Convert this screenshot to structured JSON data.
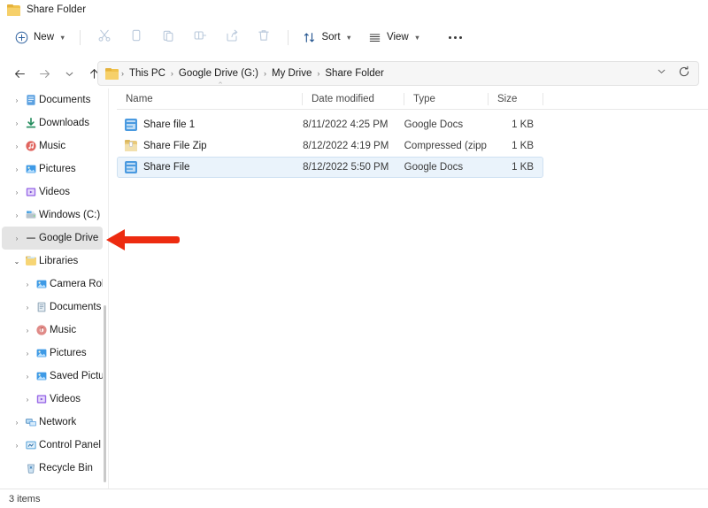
{
  "window": {
    "title": "Share Folder",
    "title_icon": "folder-icon"
  },
  "toolbar": {
    "new_label": "New",
    "new_icon": "plus-circle-icon",
    "sort_label": "Sort",
    "sort_icon": "sort-arrows-icon",
    "view_label": "View",
    "view_icon": "list-lines-icon",
    "more_label": "See more",
    "more_icon": "ellipsis-icon",
    "actions": [
      {
        "name": "cut",
        "icon": "scissors-icon",
        "enabled": false
      },
      {
        "name": "copy",
        "icon": "copy-icon",
        "enabled": false
      },
      {
        "name": "paste",
        "icon": "paste-icon",
        "enabled": false
      },
      {
        "name": "rename",
        "icon": "rename-icon",
        "enabled": false
      },
      {
        "name": "share",
        "icon": "share-icon",
        "enabled": false
      },
      {
        "name": "delete",
        "icon": "trash-icon",
        "enabled": false
      }
    ]
  },
  "navigation": {
    "back_icon": "arrow-left-icon",
    "forward_icon": "arrow-right-icon",
    "recent_icon": "chevron-down-icon",
    "up_icon": "arrow-up-icon",
    "refresh_icon": "refresh-icon",
    "dropdown_icon": "chevron-down-icon",
    "breadcrumb_icon": "folder-icon",
    "breadcrumb": [
      "This PC",
      "Google Drive (G:)",
      "My Drive",
      "Share Folder"
    ],
    "separator": "›"
  },
  "sidebar": {
    "items": [
      {
        "label": "Documents",
        "icon": "documents-icon",
        "indent": 1,
        "expander": "right",
        "selected": false
      },
      {
        "label": "Downloads",
        "icon": "downloads-icon",
        "indent": 1,
        "expander": "right",
        "selected": false
      },
      {
        "label": "Music",
        "icon": "music-icon",
        "indent": 1,
        "expander": "right",
        "selected": false
      },
      {
        "label": "Pictures",
        "icon": "pictures-icon",
        "indent": 1,
        "expander": "right",
        "selected": false
      },
      {
        "label": "Videos",
        "icon": "videos-icon",
        "indent": 1,
        "expander": "right",
        "selected": false
      },
      {
        "label": "Windows (C:)",
        "icon": "drive-icon",
        "indent": 1,
        "expander": "right",
        "selected": false
      },
      {
        "label": "Google Drive",
        "icon": "google-drive-icon",
        "indent": 1,
        "expander": "right",
        "selected": true
      },
      {
        "label": "Libraries",
        "icon": "libraries-icon",
        "indent": 0,
        "expander": "down",
        "selected": false
      },
      {
        "label": "Camera Roll",
        "icon": "pictures-icon",
        "indent": 2,
        "expander": "right",
        "selected": false
      },
      {
        "label": "Documents",
        "icon": "documents-lib-icon",
        "indent": 2,
        "expander": "right",
        "selected": false
      },
      {
        "label": "Music",
        "icon": "music-lib-icon",
        "indent": 2,
        "expander": "right",
        "selected": false
      },
      {
        "label": "Pictures",
        "icon": "pictures-icon",
        "indent": 2,
        "expander": "right",
        "selected": false
      },
      {
        "label": "Saved Picture",
        "icon": "pictures-icon",
        "indent": 2,
        "expander": "right",
        "selected": false
      },
      {
        "label": "Videos",
        "icon": "videos-icon",
        "indent": 2,
        "expander": "right",
        "selected": false
      },
      {
        "label": "Network",
        "icon": "network-icon",
        "indent": 0,
        "expander": "right",
        "selected": false
      },
      {
        "label": "Control Panel",
        "icon": "control-panel-icon",
        "indent": 0,
        "expander": "right",
        "selected": false
      },
      {
        "label": "Recycle Bin",
        "icon": "recycle-bin-icon",
        "indent": 0,
        "expander": "none",
        "selected": false
      }
    ]
  },
  "filelist": {
    "columns": [
      {
        "key": "name",
        "label": "Name",
        "sorted": "asc"
      },
      {
        "key": "date",
        "label": "Date modified",
        "sorted": ""
      },
      {
        "key": "type",
        "label": "Type",
        "sorted": ""
      },
      {
        "key": "size",
        "label": "Size",
        "sorted": ""
      }
    ],
    "sort_caret": "⌃",
    "rows": [
      {
        "name": "Share file 1",
        "date": "8/11/2022 4:25 PM",
        "type": "Google Docs",
        "size": "1 KB",
        "icon": "google-docs-icon",
        "selected": false
      },
      {
        "name": "Share File Zip",
        "date": "8/12/2022 4:19 PM",
        "type": "Compressed (zipp...",
        "size": "1 KB",
        "icon": "zip-folder-icon",
        "selected": false
      },
      {
        "name": "Share File",
        "date": "8/12/2022 5:50 PM",
        "type": "Google Docs",
        "size": "1 KB",
        "icon": "google-docs-icon",
        "selected": true
      }
    ]
  },
  "statusbar": {
    "item_count": "3 items"
  },
  "annotation": {
    "arrow_color": "#ED2B10",
    "arrow_direction": "left",
    "points_at": "Google Drive"
  }
}
